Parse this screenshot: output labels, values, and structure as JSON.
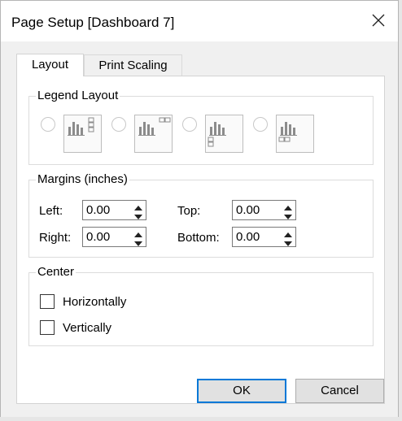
{
  "dialog": {
    "title": "Page Setup [Dashboard 7]"
  },
  "tabs": [
    {
      "label": "Layout",
      "active": true
    },
    {
      "label": "Print Scaling",
      "active": false
    }
  ],
  "legend_layout": {
    "title": "Legend Layout",
    "options": [
      {
        "name": "legend-right-top",
        "selected": false
      },
      {
        "name": "legend-top-right",
        "selected": false
      },
      {
        "name": "legend-bottom-left",
        "selected": false
      },
      {
        "name": "legend-below-left",
        "selected": false
      }
    ]
  },
  "margins": {
    "title": "Margins (inches)",
    "left_label": "Left:",
    "left_value": "0.00",
    "right_label": "Right:",
    "right_value": "0.00",
    "top_label": "Top:",
    "top_value": "0.00",
    "bottom_label": "Bottom:",
    "bottom_value": "0.00"
  },
  "center": {
    "title": "Center",
    "horizontally_label": "Horizontally",
    "horizontally_checked": false,
    "vertically_label": "Vertically",
    "vertically_checked": false
  },
  "buttons": {
    "ok_label": "OK",
    "cancel_label": "Cancel"
  },
  "colors": {
    "accent": "#0078d7",
    "dialog_background": "#f0f0f0",
    "panel_background": "#ffffff"
  },
  "icons": {
    "close": "close-icon",
    "spin_up": "spin-up-icon",
    "spin_down": "spin-down-icon",
    "layout_thumbnail": "bar-chart-legend-icon"
  }
}
